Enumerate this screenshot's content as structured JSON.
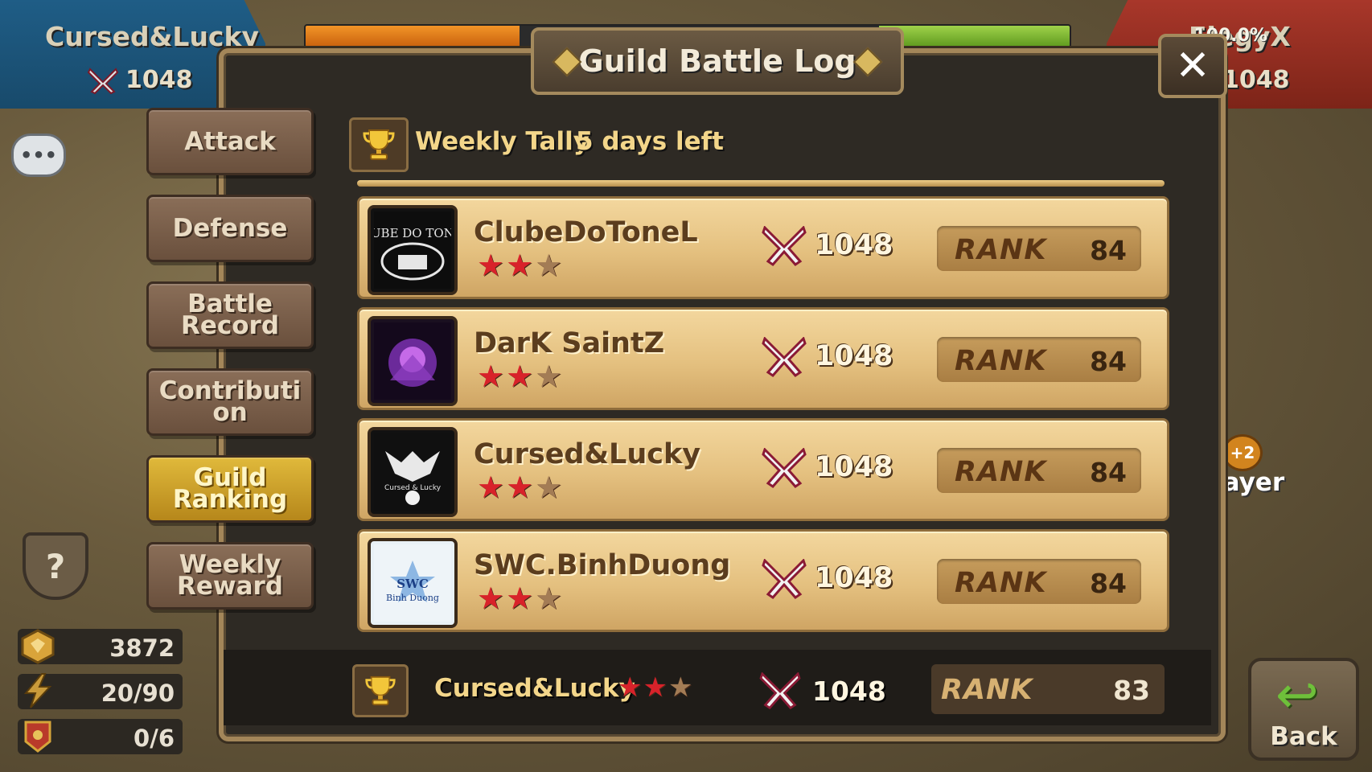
{
  "header": {
    "left_team": {
      "name": "Cursed&Lucky",
      "score": "1048"
    },
    "right_team": {
      "name": "ElegyX",
      "score": "1048"
    },
    "progress_text": "100.0%",
    "progress_fraction_left": 0.28
  },
  "panel": {
    "title": "Guild Battle Log",
    "close_label": "✕"
  },
  "tally": {
    "label": "Weekly Tally",
    "days_left": "5 days left"
  },
  "side_tabs": [
    {
      "label": "Attack",
      "active": false
    },
    {
      "label": "Defense",
      "active": false
    },
    {
      "label": "Battle Record",
      "active": false
    },
    {
      "label": "Contributi on",
      "active": false
    },
    {
      "label": "Guild Ranking",
      "active": true
    },
    {
      "label": "Weekly Reward",
      "active": false
    }
  ],
  "guilds": [
    {
      "name": "ClubeDoToneL",
      "stars": 2,
      "score": "1048",
      "rank_label": "RANK",
      "rank": "84",
      "emblem": "clube-do-tonel-emblem"
    },
    {
      "name": "DarK SaintZ",
      "stars": 2,
      "score": "1048",
      "rank_label": "RANK",
      "rank": "84",
      "emblem": "dark-saintz-emblem"
    },
    {
      "name": "Cursed&Lucky",
      "stars": 2,
      "score": "1048",
      "rank_label": "RANK",
      "rank": "84",
      "emblem": "cursed-lucky-emblem"
    },
    {
      "name": "SWC.BinhDuong",
      "stars": 2,
      "score": "1048",
      "rank_label": "RANK",
      "rank": "84",
      "emblem": "swc-binh-duong-emblem"
    }
  ],
  "footer": {
    "name": "Cursed&Lucky",
    "stars": 2,
    "score": "1048",
    "rank_label": "RANK",
    "rank": "83"
  },
  "resources": [
    {
      "icon": "guild-points-icon",
      "value": "3872"
    },
    {
      "icon": "energy-icon",
      "value": "20/90"
    },
    {
      "icon": "battle-flag-icon",
      "value": "0/6"
    }
  ],
  "back_button": {
    "label": "Back"
  },
  "right_partial_text": "layer",
  "plus_badge": "+2",
  "colors": {
    "star_on": "#d8222a",
    "star_off": "#a37c55",
    "active_tab": "#e0b93b",
    "left_team": "#1f5d86",
    "right_team": "#a8372a"
  }
}
